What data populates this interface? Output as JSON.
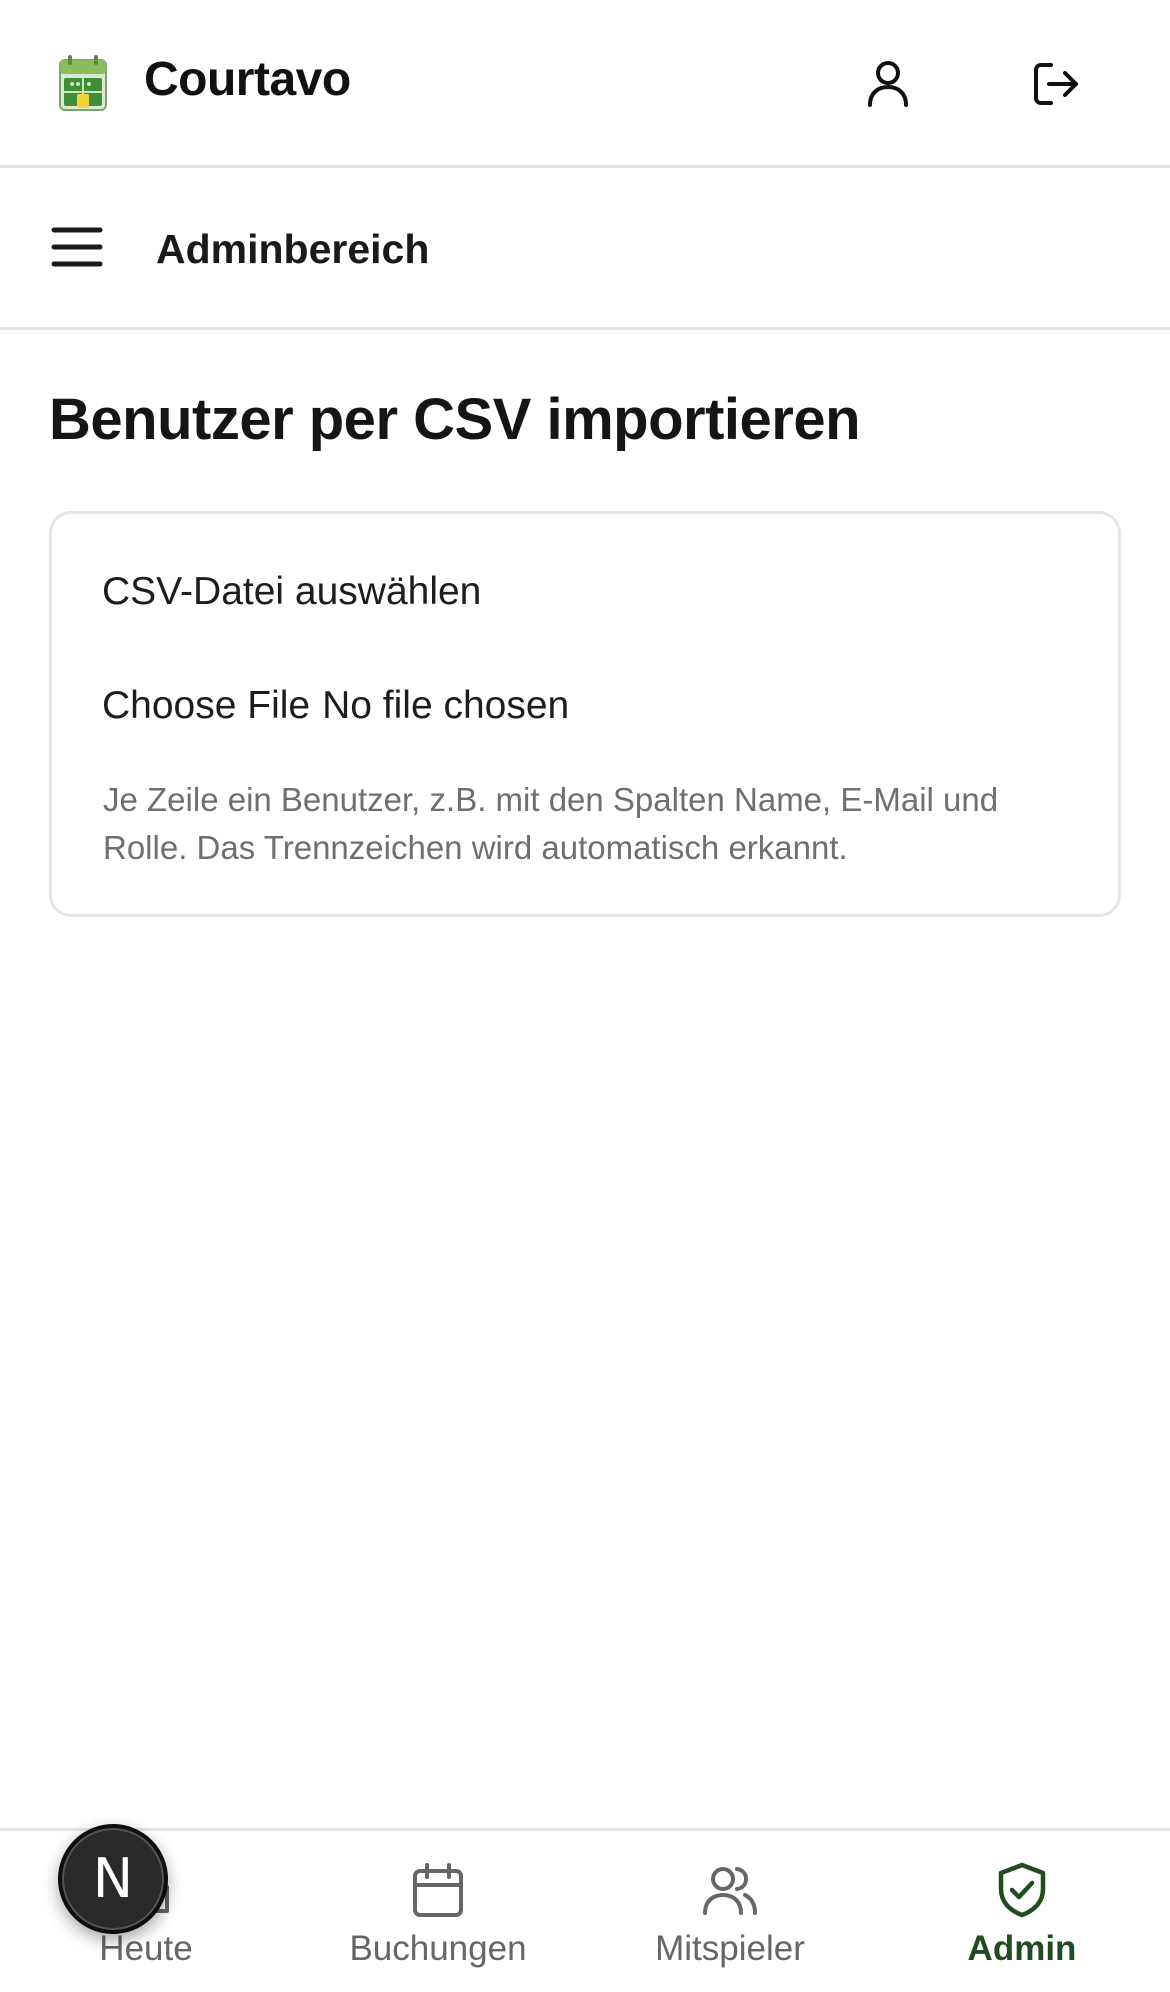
{
  "app": {
    "name": "Courtavo"
  },
  "header": {
    "user_icon": "user-icon",
    "logout_icon": "logout-icon"
  },
  "subheader": {
    "menu_icon": "hamburger-menu-icon",
    "title": "Adminbereich"
  },
  "main": {
    "title": "Benutzer per CSV importieren",
    "card": {
      "label": "CSV-Datei auswählen",
      "file_button": "Choose File",
      "file_status": "No file chosen",
      "hint": "Je Zeile ein Benutzer, z.B. mit den Spalten Name, E-Mail und Rolle. Das Trennzeichen wird automatisch erkannt."
    }
  },
  "bottom_nav": {
    "items": [
      {
        "label": "Heute",
        "icon": "home-icon",
        "active": false
      },
      {
        "label": "Buchungen",
        "icon": "calendar-icon",
        "active": false
      },
      {
        "label": "Mitspieler",
        "icon": "users-icon",
        "active": false
      },
      {
        "label": "Admin",
        "icon": "shield-check-icon",
        "active": true
      }
    ]
  },
  "fab": {
    "letter": "N"
  },
  "colors": {
    "accent": "#1f4d1f",
    "muted_text": "#6f6f6f",
    "border": "#e5e5e5"
  }
}
